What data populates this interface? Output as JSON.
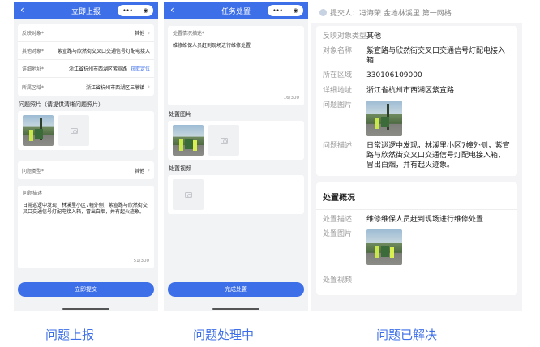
{
  "screen1": {
    "title": "立即上报",
    "back": "‹",
    "capsule_dots": "•••",
    "capsule_target": "◉",
    "rows": [
      {
        "label": "反映对象*",
        "value": "其他",
        "arrow": "›"
      },
      {
        "label": "其他对象*",
        "value": "紫宣路与欣然街交叉口交通信号灯配电接入"
      },
      {
        "label": "详细地址*",
        "value": "浙江省杭州市西湖区紫宣路",
        "link": "获取定位"
      },
      {
        "label": "所属区域*",
        "value": "浙江省杭州市西湖区三墩镇",
        "arrow": "›"
      }
    ],
    "photo_section": "问题照片（请提供清晰问题照片）",
    "type_row": {
      "label": "问题类型*",
      "value": "其他",
      "arrow": "›"
    },
    "desc_label": "问题描述",
    "desc_text": "日常巡逻中发现，林溪里小区7幢外侧，紫宣路与欣然街交叉口交通信号灯配电接入箱，冒出白烟，并有起火迹象。",
    "counter": "51/300",
    "button": "立即提交"
  },
  "screen2": {
    "title": "任务处置",
    "back": "‹",
    "capsule_dots": "•••",
    "capsule_target": "◉",
    "desc_label": "处置情况描述*",
    "desc_text": "维修维保人员赶到现场进行维修处置",
    "counter": "16/300",
    "img_section": "处置图片",
    "video_section": "处置视频",
    "button": "完成处置"
  },
  "screen3": {
    "reporter": "提交人：冯海荣 金地林溪里 第一网格",
    "rows": [
      {
        "label": "反映对象类型",
        "value": "其他"
      },
      {
        "label": "对象名称",
        "value": "紫宣路与欣然街交叉口交通信号灯配电接入箱"
      },
      {
        "label": "所在区域",
        "value": "330106109000"
      },
      {
        "label": "详细地址",
        "value": "浙江省杭州市西湖区紫宣路"
      }
    ],
    "img_label": "问题图片",
    "desc_label": "问题描述",
    "desc_text": "日常巡逻中发现，林溪里小区7幢外侧，紫宣路与欣然街交叉口交通信号灯配电接入箱，冒出白烟，并有起火迹象。",
    "section_title": "处置概况",
    "handle_desc_label": "处置描述",
    "handle_desc_text": "维修维保人员赶到现场进行维修处置",
    "handle_img_label": "处置图片",
    "handle_video_label": "处置视频"
  },
  "captions": [
    "问题上报",
    "问题处理中",
    "问题已解决"
  ],
  "colors": {
    "accent": "#3d6fe8",
    "background": "#f2f3f5"
  }
}
